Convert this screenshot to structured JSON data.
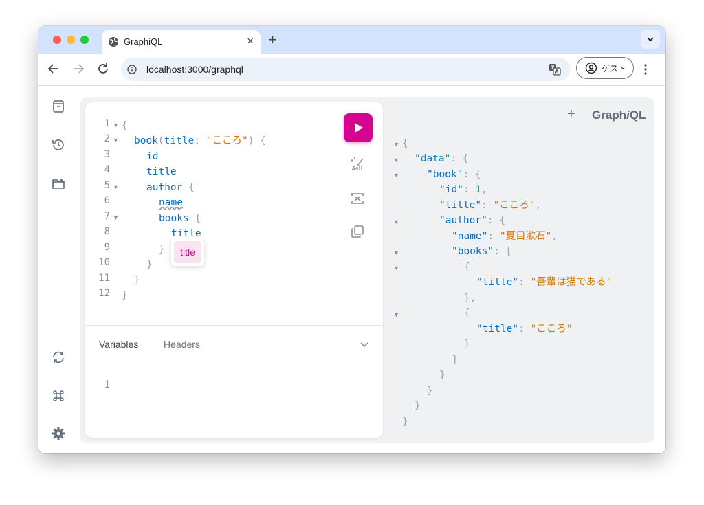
{
  "browser": {
    "tab_title": "GraphiQL",
    "tab_close": "×",
    "new_tab": "+",
    "url": "localhost:3000/graphql",
    "profile_label": "ゲスト",
    "traffic_colors": [
      "#ff5f57",
      "#febc2e",
      "#28c840"
    ]
  },
  "graphiql": {
    "brand_prefix": "Graph",
    "brand_italic": "i",
    "brand_suffix": "QL",
    "add_tab": "+",
    "accent_color": "#d60590",
    "line_numbers": [
      "1",
      "2",
      "3",
      "4",
      "5",
      "6",
      "7",
      "8",
      "9",
      "10",
      "11",
      "12"
    ],
    "query": {
      "l1": "{",
      "l2_field": "book",
      "l2_arg": "title",
      "l2_value": "\"こころ\"",
      "l2_tail": ") {",
      "l3": "id",
      "l4": "title",
      "l5_field": "author",
      "l5_brace": "{",
      "l6": "name",
      "l7_field": "books",
      "l7_brace": "{",
      "l8": "title",
      "l9": "}",
      "l10": "}",
      "l11": "}",
      "l12": "}"
    },
    "autocomplete_item": "title",
    "bottom_tabs": {
      "variables": "Variables",
      "headers": "Headers"
    },
    "variables_line_number": "1",
    "response": {
      "k_data": "\"data\"",
      "k_book": "\"book\"",
      "k_id": "\"id\"",
      "v_id": "1",
      "k_title": "\"title\"",
      "v_title": "\"こころ\"",
      "k_author": "\"author\"",
      "k_name": "\"name\"",
      "v_name": "\"夏目漱石\"",
      "k_books": "\"books\"",
      "k_title2": "\"title\"",
      "v_title2": "\"吾輩は猫である\"",
      "k_title3": "\"title\"",
      "v_title3": "\"こころ\""
    }
  }
}
